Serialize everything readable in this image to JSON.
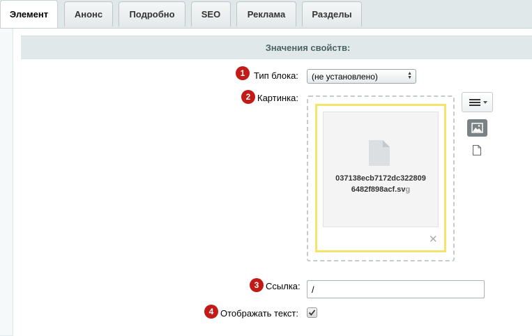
{
  "tabs": [
    {
      "label": "Элемент",
      "active": true
    },
    {
      "label": "Анонс"
    },
    {
      "label": "Подробно"
    },
    {
      "label": "SEO"
    },
    {
      "label": "Реклама"
    },
    {
      "label": "Разделы"
    }
  ],
  "section_title": "Значения свойств:",
  "fields": {
    "block_type": {
      "badge": "1",
      "label": "Тип блока:",
      "value": "(не установлено)"
    },
    "picture": {
      "badge": "2",
      "label": "Картинка:",
      "file_name_line1": "037138ecb7172dc322809",
      "file_name_line2": "6482f898acf.sv",
      "file_name_tail": "g",
      "remove_symbol": "✕"
    },
    "link": {
      "badge": "3",
      "label": "Ссылка:",
      "value": "/"
    },
    "show_text": {
      "badge": "4",
      "label": "Отображать текст:",
      "checked": true
    }
  },
  "icons": {
    "menu": "menu-dropdown-icon",
    "image": "image-icon",
    "file": "file-icon"
  },
  "colors": {
    "badge": "#c21b17",
    "highlight_border": "#f5e36b",
    "section_bg": "#e0e8ea"
  }
}
